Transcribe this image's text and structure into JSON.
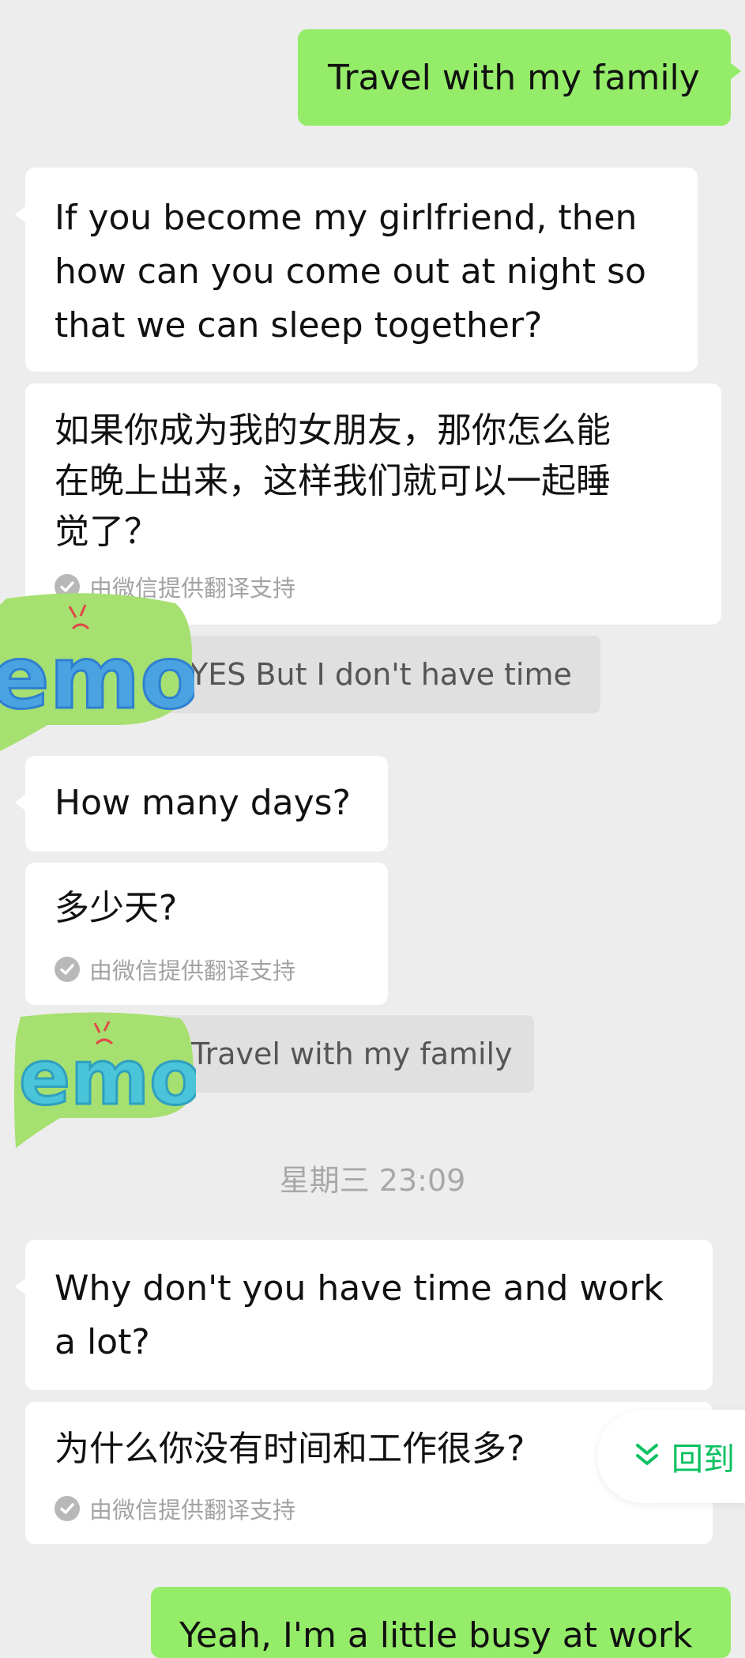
{
  "messages": {
    "sent_1": "Travel with my family",
    "received_1": "If you become my girlfriend, then\nhow can you come out at night so\nthat we can sleep together?",
    "received_1_translation": "如果你成为我的女朋友，那你怎么能\n在晚上出来，这样我们就可以一起睡\n觉了？",
    "translation_note": "由微信提供翻译支持",
    "quote_1": "YES But I don't have time",
    "received_2": "How many days?",
    "received_2_translation": "多少天?",
    "quote_2": "Travel with my family",
    "timestamp": "星期三 23:09",
    "received_3": "Why don't you have time and work\na lot?",
    "received_3_translation": "为什么你没有时间和工作很多?",
    "sent_2_partial": "Yeah, I'm a little busy at work"
  },
  "back_to_bottom": {
    "label": "回到"
  },
  "sticker": {
    "text": "emo"
  },
  "colors": {
    "background": "#ededed",
    "sent_bubble": "#95ec69",
    "received_bubble": "#ffffff",
    "accent": "#07c160"
  }
}
